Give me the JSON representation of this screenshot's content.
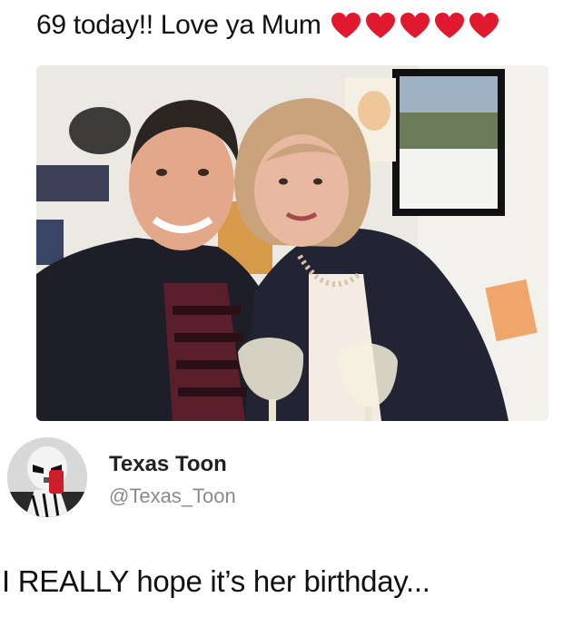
{
  "meme": {
    "top_caption": "69 today!! Love ya Mum",
    "heart_count": 5,
    "heart_color": "#e0192e"
  },
  "photo": {
    "description_icon": "selfie-photo"
  },
  "tweet": {
    "display_name": "Texas Toon",
    "handle": "@Texas_Toon",
    "text": "I REALLY hope it’s her birthday...",
    "avatar_icon": "stormtrooper-avatar"
  },
  "colors": {
    "background": "#ffffff",
    "text": "#111111",
    "handle": "#8a8a8a"
  }
}
